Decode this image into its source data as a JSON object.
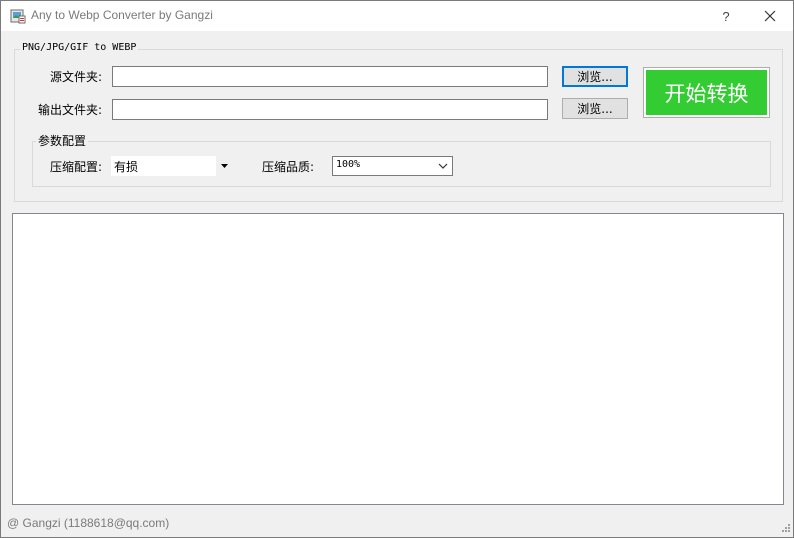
{
  "window": {
    "title": "Any to Webp Converter by Gangzi",
    "help_label": "?",
    "close_icon": "close-icon"
  },
  "group": {
    "title": "PNG/JPG/GIF to WEBP",
    "source_label": "源文件夹:",
    "source_value": "",
    "output_label": "输出文件夹:",
    "output_value": "",
    "browse_label": "浏览...",
    "browse2_label": "浏览...",
    "start_label": "开始转换",
    "start_color": "#33cc33"
  },
  "params": {
    "title": "参数配置",
    "compress_mode_label": "压缩配置:",
    "compress_mode_value": "有损",
    "quality_label": "压缩品质:",
    "quality_value": "100%"
  },
  "log": {
    "text": ""
  },
  "status": {
    "text": "@ Gangzi (1188618@qq.com)"
  }
}
